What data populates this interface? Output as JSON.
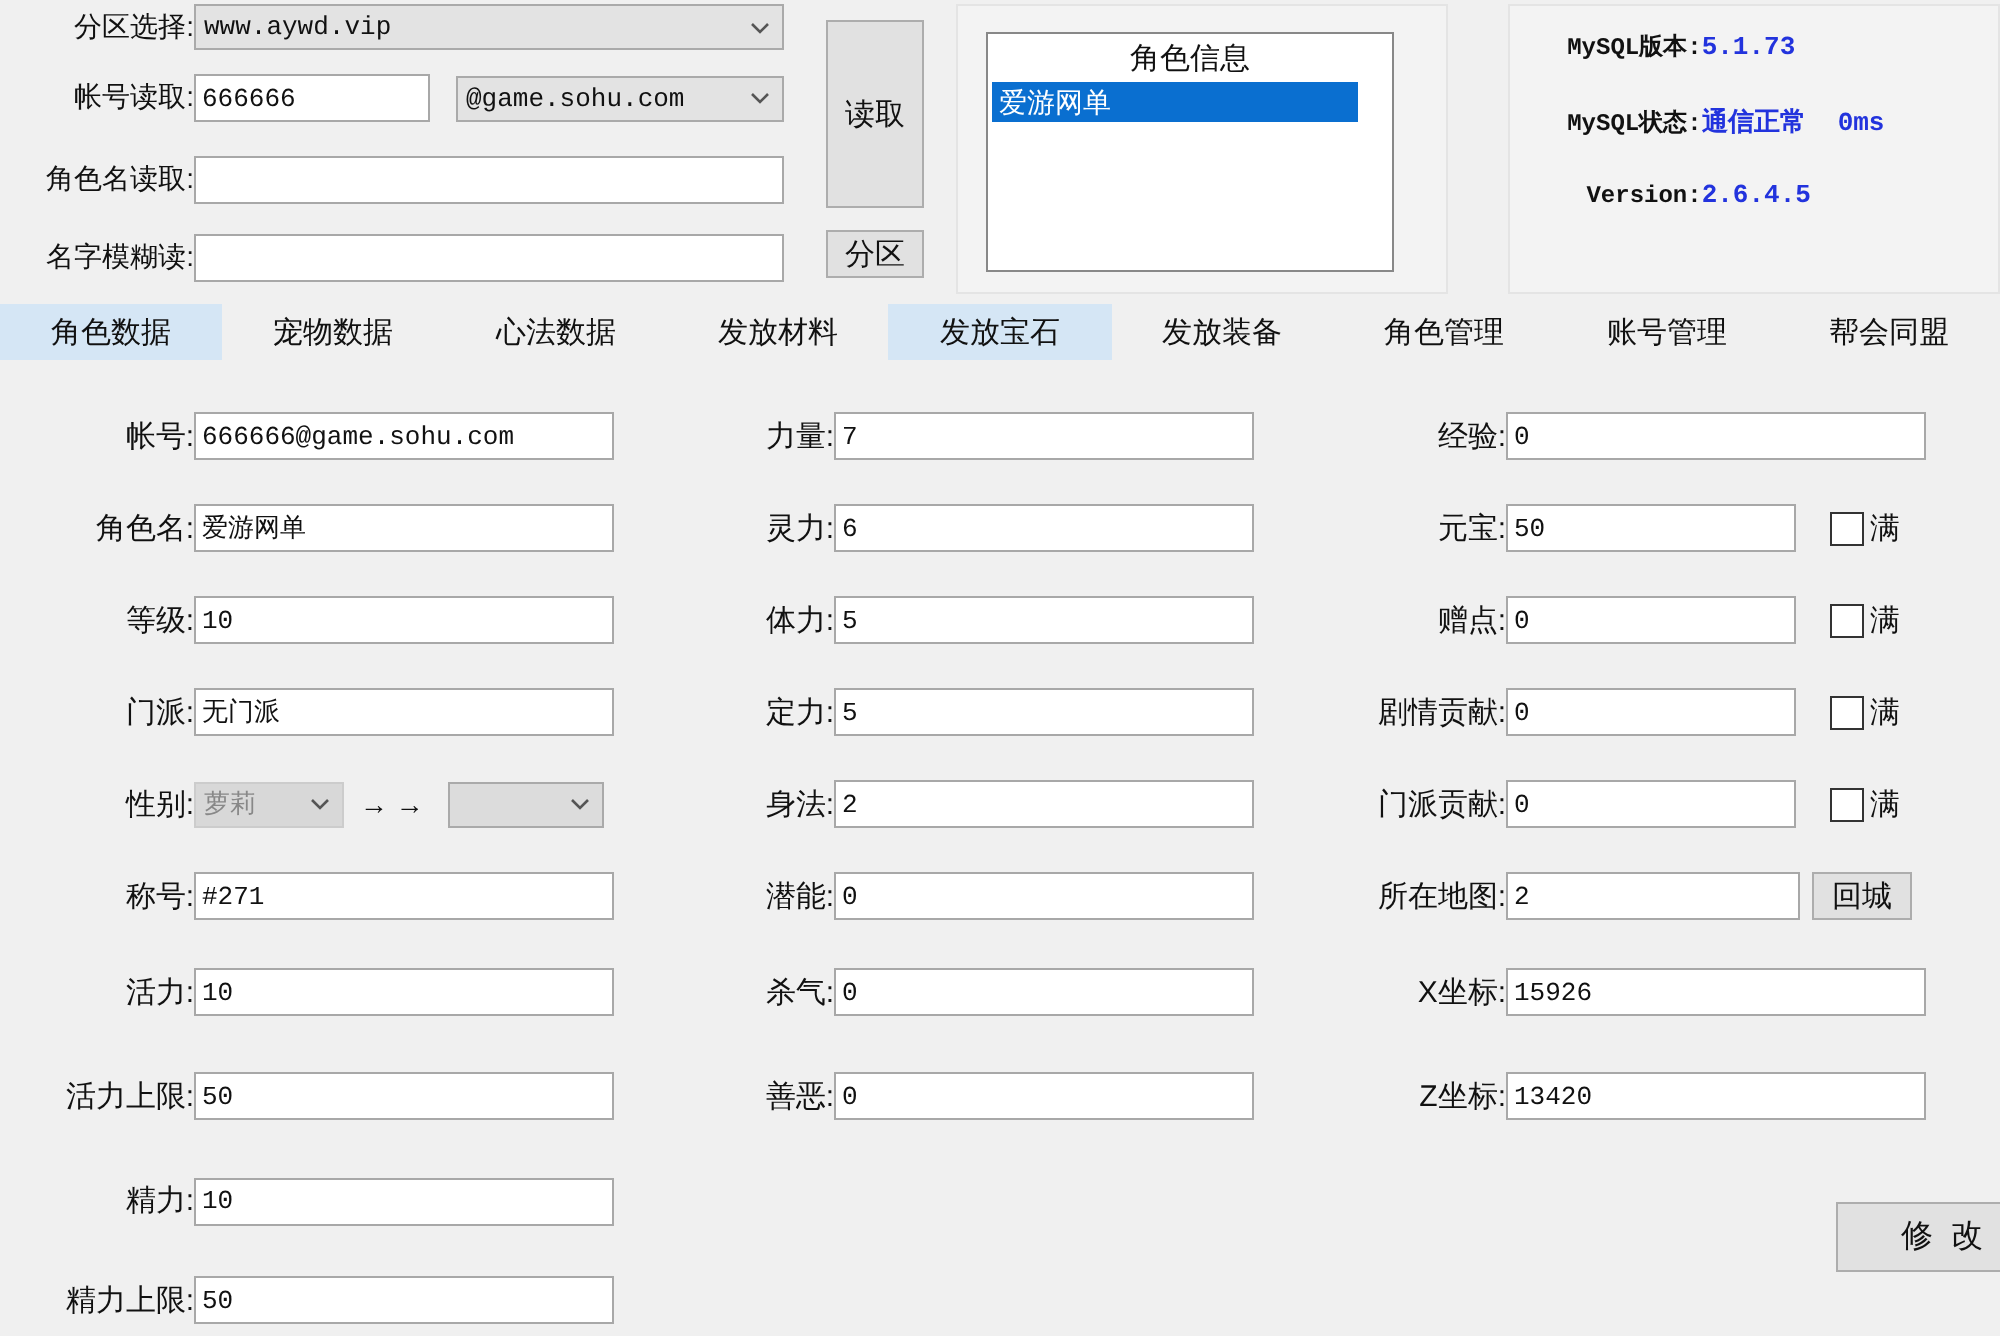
{
  "header": {
    "zone": {
      "label": "分区选择:",
      "value": "www.aywd.vip"
    },
    "account": {
      "label": "帐号读取:",
      "value": "666666",
      "domain": "@game.sohu.com"
    },
    "role_name": {
      "label": "角色名读取:"
    },
    "fuzzy_name": {
      "label": "名字模糊读:"
    },
    "read_button": "读取",
    "zone_button": "分区",
    "role_list": {
      "title": "角色信息",
      "items": [
        {
          "name": "爱游网单",
          "selected": true
        }
      ]
    },
    "server_info": [
      {
        "label": "MySQL版本:",
        "value": "5.1.73"
      },
      {
        "label": "MySQL状态:",
        "value": "通信正常",
        "extra": "0ms"
      },
      {
        "label": "Version:",
        "value": "2.6.4.5"
      }
    ]
  },
  "tabs": [
    {
      "label": "角色数据",
      "highlighted": true
    },
    {
      "label": "宠物数据",
      "highlighted": false
    },
    {
      "label": "心法数据",
      "highlighted": false
    },
    {
      "label": "发放材料",
      "highlighted": false
    },
    {
      "label": "发放宝石",
      "highlighted": true
    },
    {
      "label": "发放装备",
      "highlighted": false
    },
    {
      "label": "角色管理",
      "highlighted": false
    },
    {
      "label": "账号管理",
      "highlighted": false
    },
    {
      "label": "帮会同盟",
      "highlighted": false
    }
  ],
  "columns": [
    {
      "fields": [
        {
          "kind": "text",
          "label": "帐号:",
          "value": "666666@game.sohu.com"
        },
        {
          "kind": "text",
          "label": "角色名:",
          "value": "爱游网单"
        },
        {
          "kind": "text",
          "label": "等级:",
          "value": "10"
        },
        {
          "kind": "text",
          "label": "门派:",
          "value": "无门派"
        },
        {
          "kind": "gender",
          "label": "性别:",
          "value": "萝莉",
          "arrows": "→ →"
        },
        {
          "kind": "text",
          "label": "称号:",
          "value": "#271"
        },
        {
          "kind": "text",
          "label": "活力:",
          "value": "10"
        },
        {
          "kind": "text",
          "label": "活力上限:",
          "value": "50"
        },
        {
          "kind": "text",
          "label": "精力:",
          "value": "10"
        },
        {
          "kind": "text",
          "label": "精力上限:",
          "value": "50"
        }
      ]
    },
    {
      "fields": [
        {
          "kind": "text",
          "label": "力量:",
          "value": "7"
        },
        {
          "kind": "text",
          "label": "灵力:",
          "value": "6"
        },
        {
          "kind": "text",
          "label": "体力:",
          "value": "5"
        },
        {
          "kind": "text",
          "label": "定力:",
          "value": "5"
        },
        {
          "kind": "text",
          "label": "身法:",
          "value": "2"
        },
        {
          "kind": "text",
          "label": "潜能:",
          "value": "0"
        },
        {
          "kind": "text",
          "label": "杀气:",
          "value": "0"
        },
        {
          "kind": "text",
          "label": "善恶:",
          "value": "0"
        }
      ]
    },
    {
      "fields": [
        {
          "kind": "text",
          "label": "经验:",
          "value": "0"
        },
        {
          "kind": "check",
          "label": "元宝:",
          "value": "50",
          "check_label": "满",
          "checked": false
        },
        {
          "kind": "check",
          "label": "赠点:",
          "value": "0",
          "check_label": "满",
          "checked": false
        },
        {
          "kind": "check",
          "label": "剧情贡献:",
          "value": "0",
          "check_label": "满",
          "checked": false
        },
        {
          "kind": "check",
          "label": "门派贡献:",
          "value": "0",
          "check_label": "满",
          "checked": false
        },
        {
          "kind": "button",
          "label": "所在地图:",
          "value": "2",
          "button": "回城"
        },
        {
          "kind": "text",
          "label": "X坐标:",
          "value": "15926"
        },
        {
          "kind": "text",
          "label": "Z坐标:",
          "value": "13420"
        },
        {
          "kind": "action",
          "button": "修  改"
        }
      ]
    }
  ]
}
